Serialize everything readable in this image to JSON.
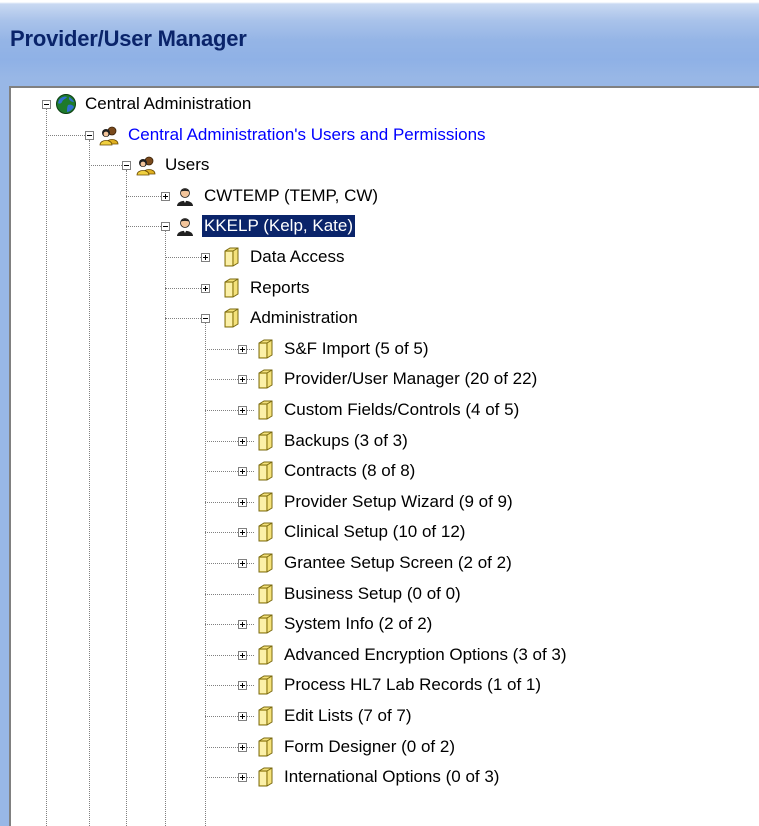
{
  "window": {
    "title": "Provider/User Manager"
  },
  "tree": {
    "root": {
      "label": "Central Administration",
      "icon": "globe-icon",
      "expanded": true
    },
    "users_and_permissions": {
      "label": "Central Administration's Users and Permissions",
      "icon": "users-group-icon",
      "expanded": true,
      "color": "#0000ff"
    },
    "users": {
      "label": "Users",
      "icon": "users-group-icon",
      "expanded": true
    },
    "user_items": [
      {
        "label": "CWTEMP (TEMP, CW)",
        "icon": "user-icon",
        "expanded": false,
        "selected": false
      },
      {
        "label": "KKELP (Kelp, Kate)",
        "icon": "user-icon",
        "expanded": true,
        "selected": true
      }
    ],
    "kkelp_children": [
      {
        "label": "Data Access",
        "icon": "folder-icon",
        "expanded": false
      },
      {
        "label": "Reports",
        "icon": "folder-icon",
        "expanded": false
      },
      {
        "label": "Administration",
        "icon": "folder-icon",
        "expanded": true
      }
    ],
    "administration_children": [
      {
        "label": "S&F Import (5 of 5)",
        "has_children": true
      },
      {
        "label": "Provider/User Manager (20 of 22)",
        "has_children": true
      },
      {
        "label": "Custom Fields/Controls (4 of 5)",
        "has_children": true
      },
      {
        "label": "Backups (3 of 3)",
        "has_children": true
      },
      {
        "label": "Contracts (8 of 8)",
        "has_children": true
      },
      {
        "label": "Provider Setup Wizard (9 of 9)",
        "has_children": true
      },
      {
        "label": "Clinical Setup (10 of 12)",
        "has_children": true
      },
      {
        "label": "Grantee Setup Screen (2 of 2)",
        "has_children": true
      },
      {
        "label": "Business Setup (0 of 0)",
        "has_children": false
      },
      {
        "label": "System Info (2 of 2)",
        "has_children": true
      },
      {
        "label": "Advanced Encryption Options (3 of 3)",
        "has_children": true
      },
      {
        "label": "Process HL7 Lab Records (1 of 1)",
        "has_children": true
      },
      {
        "label": "Edit Lists (7 of 7)",
        "has_children": true
      },
      {
        "label": "Form Designer (0 of 2)",
        "has_children": true
      },
      {
        "label": "International Options (0 of 3)",
        "has_children": true
      }
    ]
  },
  "colors": {
    "title_text": "#0a246a",
    "selection_bg": "#0a246a",
    "link_blue": "#0000ff",
    "folder_yellow": "#f5e27a"
  }
}
